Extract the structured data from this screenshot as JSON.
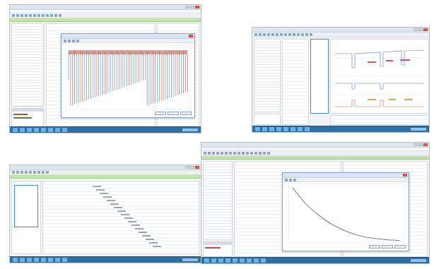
{
  "screens": [
    {
      "id": "top-left"
    },
    {
      "id": "top-right"
    },
    {
      "id": "bottom-left"
    },
    {
      "id": "bottom-right"
    }
  ],
  "colors": {
    "taskbar": "#2f6fa3",
    "accent": "#3a8bd6",
    "highlight_green": "#bfe3a8",
    "series_red": "#d9534f",
    "series_orange": "#f0a040",
    "series_teal": "#3aa6a0"
  }
}
